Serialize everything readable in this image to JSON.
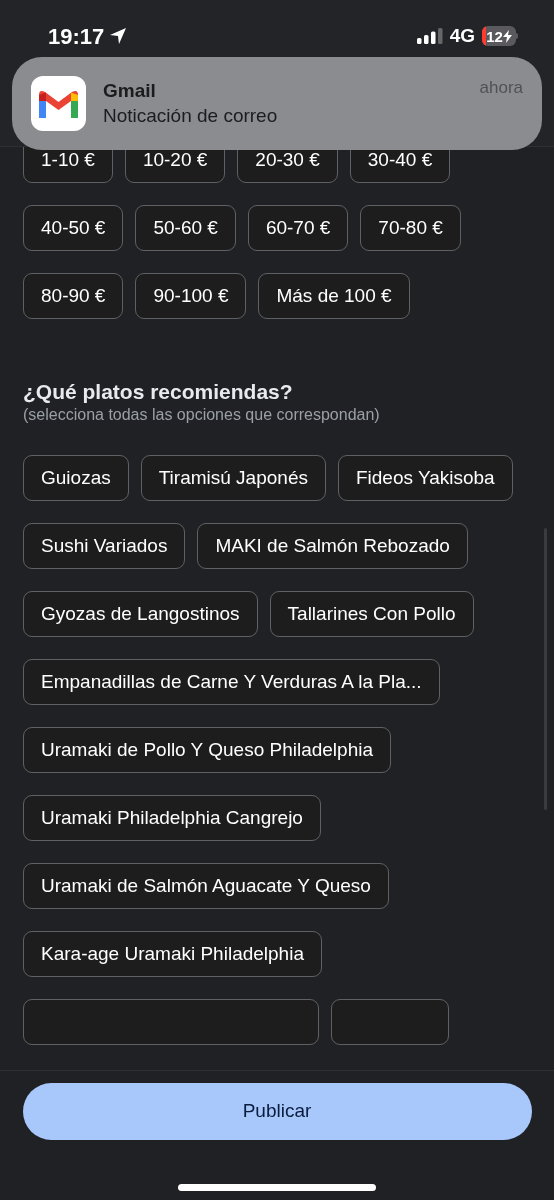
{
  "status_bar": {
    "time": "19:17",
    "network": "4G",
    "battery": "12"
  },
  "notification": {
    "app": "Gmail",
    "message": "Noticación de correo",
    "time": "ahora"
  },
  "price_options": [
    {
      "label": "1-10 €",
      "selected": false
    },
    {
      "label": "10-20 €",
      "selected": false
    },
    {
      "label": "20-30 €",
      "selected": false
    },
    {
      "label": "30-40 €",
      "selected": false
    },
    {
      "label": "40-50 €",
      "selected": false
    },
    {
      "label": "50-60 €",
      "selected": false
    },
    {
      "label": "60-70 €",
      "selected": false
    },
    {
      "label": "70-80 €",
      "selected": false
    },
    {
      "label": "80-90 €",
      "selected": false
    },
    {
      "label": "90-100 €",
      "selected": false
    },
    {
      "label": "Más de 100 €",
      "selected": false
    }
  ],
  "dishes_question": {
    "title": "¿Qué platos recomiendas?",
    "hint": "(selecciona todas las opciones que correspondan)"
  },
  "dish_options": [
    {
      "kind": "chip",
      "label": "Guiozas",
      "selected": false
    },
    {
      "kind": "chip",
      "label": "Tiramisú Japonés",
      "selected": false
    },
    {
      "kind": "chip",
      "label": "Fideos Yakisoba",
      "selected": false
    },
    {
      "kind": "chip",
      "label": "Sushi Variados",
      "selected": false
    },
    {
      "kind": "chip",
      "label": "MAKI de Salmón Rebozado",
      "selected": false
    },
    {
      "kind": "chip",
      "label": "Gyozas de Langostinos",
      "selected": false
    },
    {
      "kind": "chip",
      "label": "Tallarines Con Pollo",
      "selected": false
    },
    {
      "kind": "chip",
      "label": "Empanadillas de Carne Y Verduras A la Pla...",
      "selected": false
    },
    {
      "kind": "chip",
      "label": "Uramaki de Pollo Y Queso Philadelphia",
      "selected": false
    },
    {
      "kind": "chip",
      "label": "Uramaki Philadelphia Cangrejo",
      "selected": false
    },
    {
      "kind": "chip",
      "label": "Uramaki de Salmón Aguacate Y Queso",
      "selected": false
    },
    {
      "kind": "chip",
      "label": "Kara-age Uramaki Philadelphia",
      "selected": false
    },
    {
      "kind": "hidden"
    },
    {
      "kind": "hidden"
    }
  ],
  "primary_button": "Publicar"
}
